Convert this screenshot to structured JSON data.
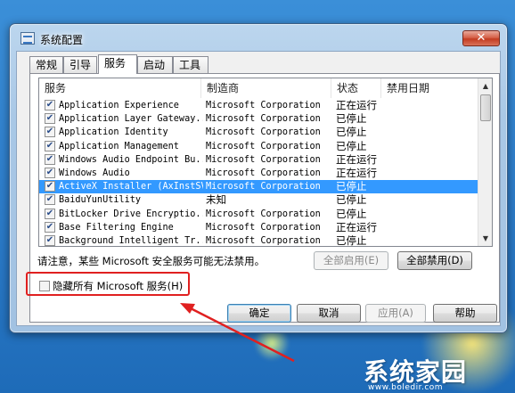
{
  "window": {
    "title": "系统配置",
    "close_label": "✕"
  },
  "tabs": [
    {
      "label": "常规",
      "active": false
    },
    {
      "label": "引导",
      "active": false
    },
    {
      "label": "服务",
      "active": true
    },
    {
      "label": "启动",
      "active": false
    },
    {
      "label": "工具",
      "active": false
    }
  ],
  "services": {
    "columns": [
      "服务",
      "制造商",
      "状态",
      "禁用日期"
    ],
    "rows": [
      {
        "name": "Application Experience",
        "maker": "Microsoft Corporation",
        "status": "正在运行",
        "checked": true
      },
      {
        "name": "Application Layer Gateway...",
        "maker": "Microsoft Corporation",
        "status": "已停止",
        "checked": true
      },
      {
        "name": "Application Identity",
        "maker": "Microsoft Corporation",
        "status": "已停止",
        "checked": true
      },
      {
        "name": "Application Management",
        "maker": "Microsoft Corporation",
        "status": "已停止",
        "checked": true
      },
      {
        "name": "Windows Audio Endpoint Bu...",
        "maker": "Microsoft Corporation",
        "status": "正在运行",
        "checked": true
      },
      {
        "name": "Windows Audio",
        "maker": "Microsoft Corporation",
        "status": "正在运行",
        "checked": true
      },
      {
        "name": "ActiveX Installer (AxInstSV)",
        "maker": "Microsoft Corporation",
        "status": "已停止",
        "checked": true,
        "selected": true
      },
      {
        "name": "BaiduYunUtility",
        "maker": "未知",
        "status": "已停止",
        "checked": true
      },
      {
        "name": "BitLocker Drive Encryptio...",
        "maker": "Microsoft Corporation",
        "status": "已停止",
        "checked": true
      },
      {
        "name": "Base Filtering Engine",
        "maker": "Microsoft Corporation",
        "status": "正在运行",
        "checked": true
      },
      {
        "name": "Background Intelligent Tr...",
        "maker": "Microsoft Corporation",
        "status": "已停止",
        "checked": true
      }
    ]
  },
  "notice": "请注意，某些 Microsoft 安全服务可能无法禁用。",
  "enable_all_label": "全部启用(E)",
  "disable_all_label": "全部禁用(D)",
  "hide_ms_label": "隐藏所有 Microsoft 服务(H)",
  "buttons": {
    "ok": "确定",
    "cancel": "取消",
    "apply": "应用(A)",
    "help": "帮助"
  },
  "watermark": {
    "main": "系统家园",
    "url": "www.boledir.com"
  },
  "colors": {
    "selection": "#3399ff",
    "annotation": "#e02020"
  }
}
